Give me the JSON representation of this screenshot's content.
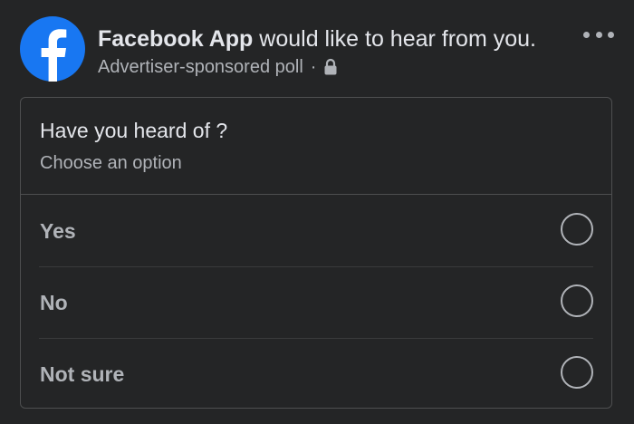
{
  "post": {
    "author": "Facebook App",
    "headline_rest": " would like to hear from you.",
    "subtitle": "Advertiser-sponsored poll",
    "separator": "·",
    "privacy_icon": "lock-icon",
    "avatar_icon": "facebook-logo-icon",
    "brand_color": "#1877f2"
  },
  "poll": {
    "question": "Have you heard of ?",
    "hint": "Choose an option",
    "options": [
      {
        "label": "Yes",
        "selected": false
      },
      {
        "label": "No",
        "selected": false
      },
      {
        "label": "Not sure",
        "selected": false
      }
    ]
  }
}
